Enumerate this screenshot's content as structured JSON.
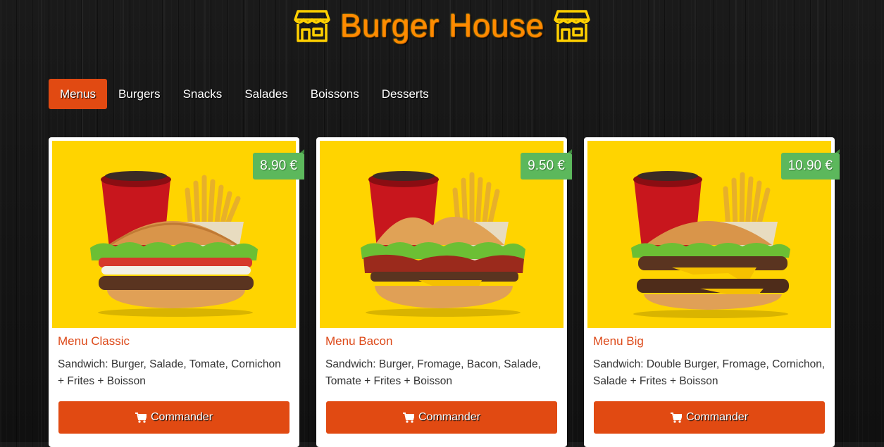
{
  "header": {
    "title": "Burger House",
    "left_icon": "shop-icon",
    "right_icon": "shop-icon"
  },
  "nav": {
    "items": [
      {
        "label": "Menus",
        "active": true
      },
      {
        "label": "Burgers",
        "active": false
      },
      {
        "label": "Snacks",
        "active": false
      },
      {
        "label": "Salades",
        "active": false
      },
      {
        "label": "Boissons",
        "active": false
      },
      {
        "label": "Desserts",
        "active": false
      }
    ]
  },
  "cards": [
    {
      "price": "8.90 €",
      "title": "Menu Classic",
      "description": "Sandwich: Burger, Salade, Tomate, Cornichon + Frites + Boisson",
      "button": "Commander"
    },
    {
      "price": "9.50 €",
      "title": "Menu Bacon",
      "description": "Sandwich: Burger, Fromage, Bacon, Salade, Tomate + Frites + Boisson",
      "button": "Commander"
    },
    {
      "price": "10.90 €",
      "title": "Menu Big",
      "description": "Sandwich: Double Burger, Fromage, Cornichon, Salade + Frites + Boisson",
      "button": "Commander"
    }
  ],
  "colors": {
    "accent": "#e14a12",
    "price_badge": "#5cb85c",
    "image_bg": "#ffd400",
    "title": "#ff8a00"
  }
}
